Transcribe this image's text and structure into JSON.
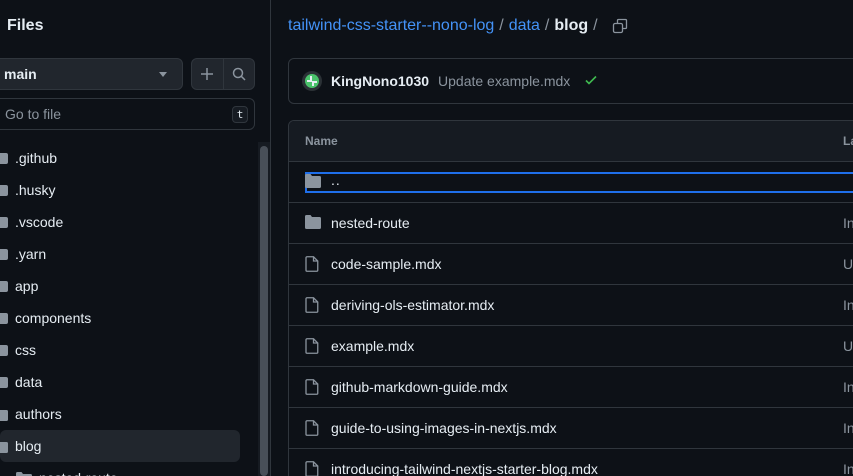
{
  "sidebar": {
    "title": "Files",
    "branch": "main",
    "goto_placeholder": "Go to file",
    "goto_shortcut": "t",
    "tree": [
      {
        "label": ".github",
        "indent": 0,
        "type": "folder"
      },
      {
        "label": ".husky",
        "indent": 0,
        "type": "folder"
      },
      {
        "label": ".vscode",
        "indent": 0,
        "type": "folder"
      },
      {
        "label": ".yarn",
        "indent": 0,
        "type": "folder"
      },
      {
        "label": "app",
        "indent": 0,
        "type": "folder"
      },
      {
        "label": "components",
        "indent": 0,
        "type": "folder"
      },
      {
        "label": "css",
        "indent": 0,
        "type": "folder"
      },
      {
        "label": "data",
        "indent": 0,
        "type": "folder"
      },
      {
        "label": "authors",
        "indent": 1,
        "type": "folder"
      },
      {
        "label": "blog",
        "indent": 1,
        "type": "folder",
        "selected": true
      },
      {
        "label": "nested-route",
        "indent": 2,
        "type": "folder"
      }
    ]
  },
  "breadcrumb": {
    "repo": "tailwind-css-starter--nono-log",
    "dir": "data",
    "current": "blog",
    "sep": "/"
  },
  "commit": {
    "author": "KingNono1030",
    "message": "Update example.mdx",
    "status": "success"
  },
  "table": {
    "col_name": "Name",
    "col_last": "La",
    "rows": [
      {
        "name": "..",
        "type": "parent",
        "last": ""
      },
      {
        "name": "nested-route",
        "type": "folder",
        "last": "In"
      },
      {
        "name": "code-sample.mdx",
        "type": "file",
        "last": "U"
      },
      {
        "name": "deriving-ols-estimator.mdx",
        "type": "file",
        "last": "In"
      },
      {
        "name": "example.mdx",
        "type": "file",
        "last": "U"
      },
      {
        "name": "github-markdown-guide.mdx",
        "type": "file",
        "last": "In"
      },
      {
        "name": "guide-to-using-images-in-nextjs.mdx",
        "type": "file",
        "last": "In"
      },
      {
        "name": "introducing-tailwind-nextjs-starter-blog.mdx",
        "type": "file",
        "last": "In"
      }
    ]
  },
  "colors": {
    "background": "#0d1117",
    "link": "#4493f8",
    "border": "#30363d",
    "success": "#3fb950",
    "focus": "#1f6feb"
  }
}
